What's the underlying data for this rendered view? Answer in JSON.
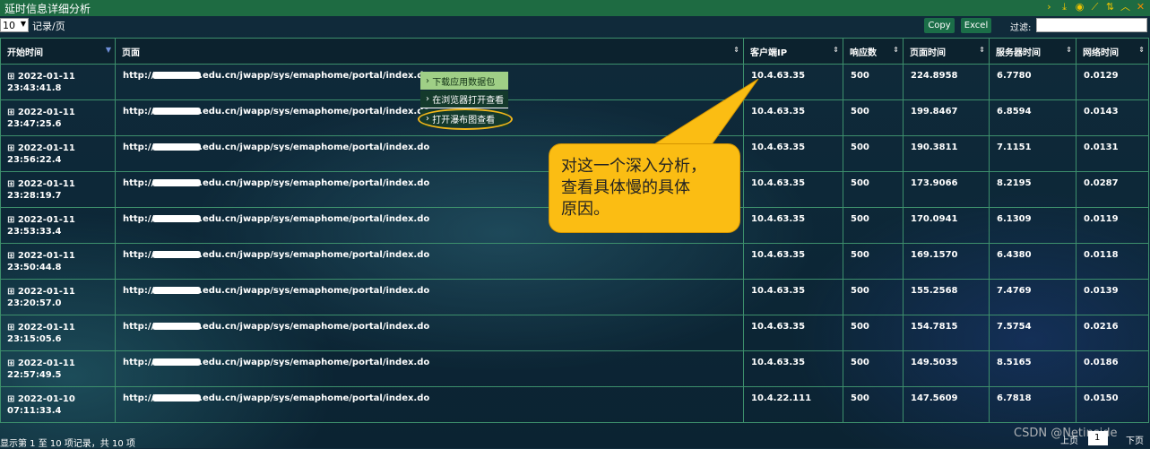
{
  "window": {
    "title": "延时信息详细分析"
  },
  "titlebar_icons": [
    "chevron-right-icon",
    "download-icon",
    "globe-icon",
    "chart-icon",
    "sort-icon",
    "collapse-icon",
    "close-icon"
  ],
  "toolbar": {
    "page_size": "10",
    "page_size_label": "记录/页",
    "copy_label": "Copy",
    "excel_label": "Excel",
    "filter_label": "过滤:",
    "filter_value": ""
  },
  "table": {
    "columns": [
      "开始时间",
      "页面",
      "客户端IP",
      "响应数",
      "页面时间",
      "服务器时间",
      "网络时间"
    ],
    "rows": [
      {
        "expand": "⊞",
        "date": "2022-01-11",
        "time": "23:43:41.8",
        "url_prefix": "http://",
        "url_suffix": ".edu.cn/jwapp/sys/emaphome/portal/index.do",
        "ip": "10.4.63.35",
        "resp": "500",
        "page_time": "224.8958",
        "server_time": "6.7780",
        "net_time": "0.0129"
      },
      {
        "expand": "⊞",
        "date": "2022-01-11",
        "time": "23:47:25.6",
        "url_prefix": "http://",
        "url_suffix": ".edu.cn/jwapp/sys/emaphome/portal/index.do",
        "ip": "10.4.63.35",
        "resp": "500",
        "page_time": "199.8467",
        "server_time": "6.8594",
        "net_time": "0.0143"
      },
      {
        "expand": "⊞",
        "date": "2022-01-11",
        "time": "23:56:22.4",
        "url_prefix": "http://",
        "url_suffix": ".edu.cn/jwapp/sys/emaphome/portal/index.do",
        "ip": "10.4.63.35",
        "resp": "500",
        "page_time": "190.3811",
        "server_time": "7.1151",
        "net_time": "0.0131"
      },
      {
        "expand": "⊞",
        "date": "2022-01-11",
        "time": "23:28:19.7",
        "url_prefix": "http://",
        "url_suffix": ".edu.cn/jwapp/sys/emaphome/portal/index.do",
        "ip": "10.4.63.35",
        "resp": "500",
        "page_time": "173.9066",
        "server_time": "8.2195",
        "net_time": "0.0287"
      },
      {
        "expand": "⊞",
        "date": "2022-01-11",
        "time": "23:53:33.4",
        "url_prefix": "http://",
        "url_suffix": ".edu.cn/jwapp/sys/emaphome/portal/index.do",
        "ip": "10.4.63.35",
        "resp": "500",
        "page_time": "170.0941",
        "server_time": "6.1309",
        "net_time": "0.0119"
      },
      {
        "expand": "⊞",
        "date": "2022-01-11",
        "time": "23:50:44.8",
        "url_prefix": "http://",
        "url_suffix": ".edu.cn/jwapp/sys/emaphome/portal/index.do",
        "ip": "10.4.63.35",
        "resp": "500",
        "page_time": "169.1570",
        "server_time": "6.4380",
        "net_time": "0.0118"
      },
      {
        "expand": "⊞",
        "date": "2022-01-11",
        "time": "23:20:57.0",
        "url_prefix": "http://",
        "url_suffix": ".edu.cn/jwapp/sys/emaphome/portal/index.do",
        "ip": "10.4.63.35",
        "resp": "500",
        "page_time": "155.2568",
        "server_time": "7.4769",
        "net_time": "0.0139"
      },
      {
        "expand": "⊞",
        "date": "2022-01-11",
        "time": "23:15:05.6",
        "url_prefix": "http://",
        "url_suffix": ".edu.cn/jwapp/sys/emaphome/portal/index.do",
        "ip": "10.4.63.35",
        "resp": "500",
        "page_time": "154.7815",
        "server_time": "7.5754",
        "net_time": "0.0216"
      },
      {
        "expand": "⊞",
        "date": "2022-01-11",
        "time": "22:57:49.5",
        "url_prefix": "http://",
        "url_suffix": ".edu.cn/jwapp/sys/emaphome/portal/index.do",
        "ip": "10.4.63.35",
        "resp": "500",
        "page_time": "149.5035",
        "server_time": "8.5165",
        "net_time": "0.0186"
      },
      {
        "expand": "⊞",
        "date": "2022-01-10",
        "time": "07:11:33.4",
        "url_prefix": "http://",
        "url_suffix": ".edu.cn/jwapp/sys/emaphome/portal/index.do",
        "ip": "10.4.22.111",
        "resp": "500",
        "page_time": "147.5609",
        "server_time": "6.7818",
        "net_time": "0.0150"
      }
    ]
  },
  "context_menu": {
    "items": [
      "下载应用数据包",
      "在浏览器打开查看",
      "打开瀑布图查看"
    ]
  },
  "callout": {
    "lines": [
      "对这一个深入分析，",
      "查看具体慢的具体",
      "原因。"
    ]
  },
  "footer": {
    "info": "显示第 1 至 10 项记录，共 10 项",
    "prev": "上页",
    "page": "1",
    "next": "下页",
    "watermark": "CSDN @Netinside"
  },
  "colors": {
    "titlebar": "#1e6b42",
    "button": "#1b6e48",
    "callout": "#fbbd13",
    "grid": "#3d8f6c"
  }
}
